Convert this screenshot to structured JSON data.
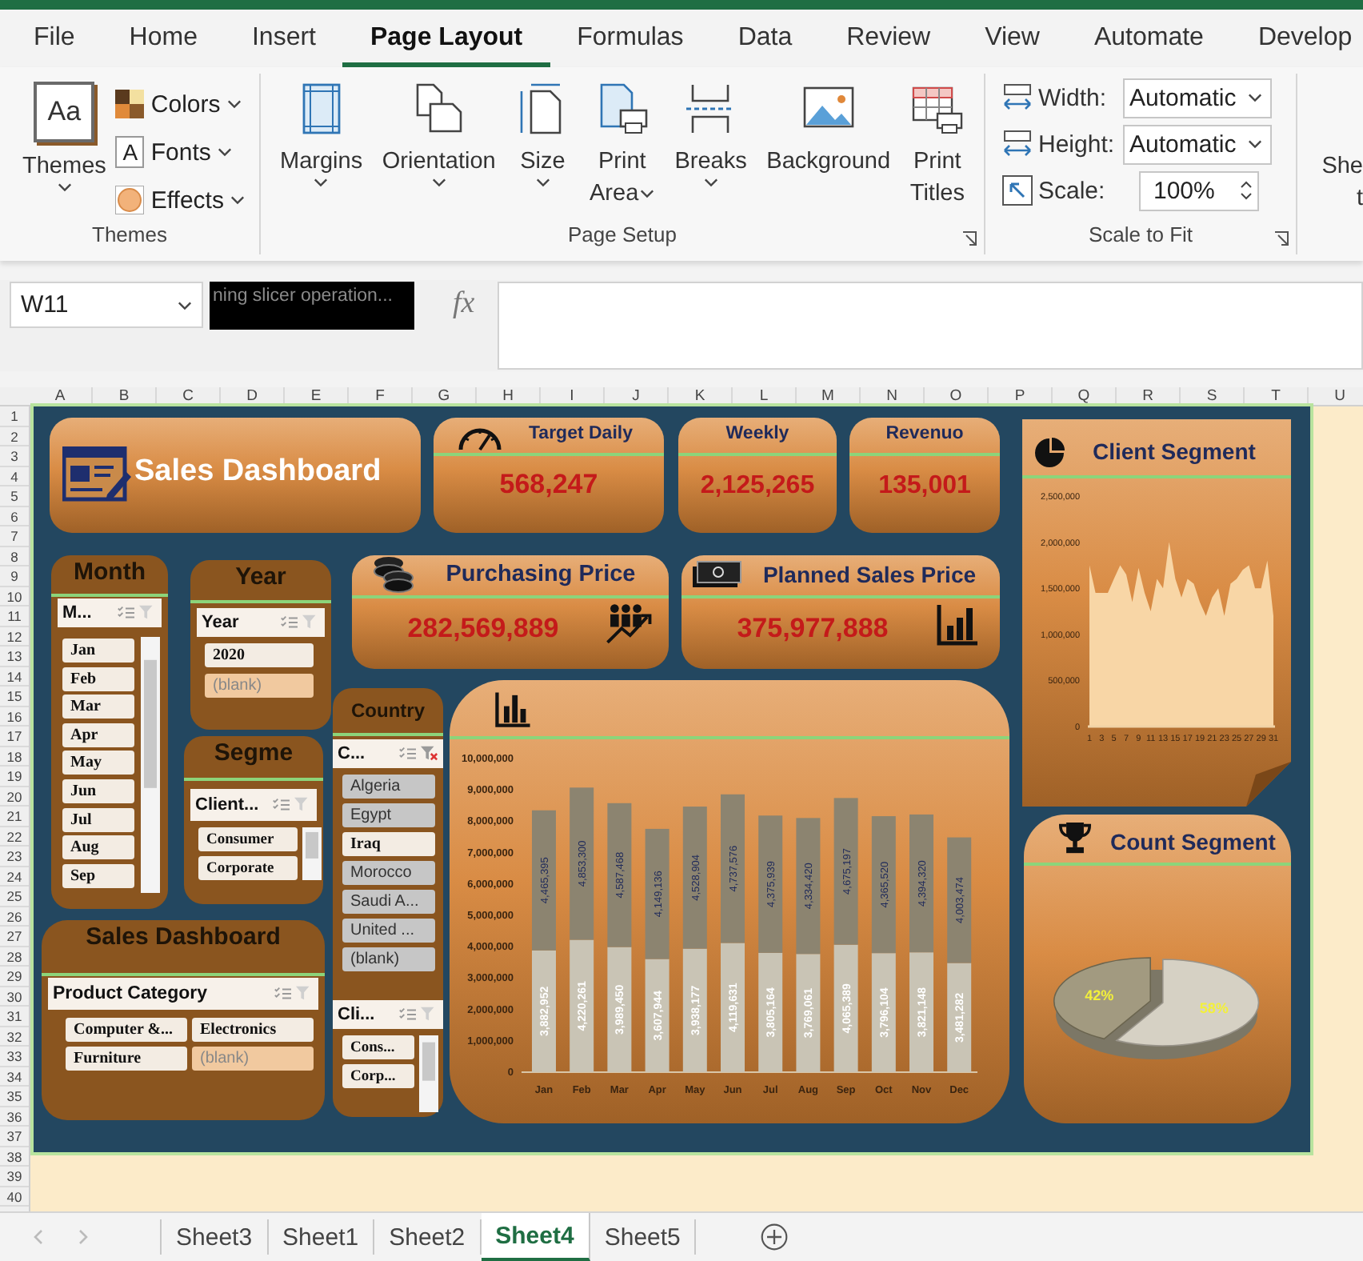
{
  "ribbon_tabs": [
    {
      "label": "File",
      "selected": false
    },
    {
      "label": "Home",
      "selected": false
    },
    {
      "label": "Insert",
      "selected": false
    },
    {
      "label": "Page Layout",
      "selected": true
    },
    {
      "label": "Formulas",
      "selected": false
    },
    {
      "label": "Data",
      "selected": false
    },
    {
      "label": "Review",
      "selected": false
    },
    {
      "label": "View",
      "selected": false
    },
    {
      "label": "Automate",
      "selected": false
    },
    {
      "label": "Develop",
      "selected": false
    }
  ],
  "themes_group": {
    "label": "Themes",
    "themes_button": {
      "icon_text": "Aa",
      "label": "Themes"
    },
    "options": [
      {
        "label": "Colors",
        "kind": "colors"
      },
      {
        "label": "Fonts",
        "kind": "fonts",
        "icon_text": "A"
      },
      {
        "label": "Effects",
        "kind": "effects"
      }
    ]
  },
  "page_setup_group": {
    "label": "Page Setup",
    "buttons": [
      {
        "lines": [
          "Margins"
        ],
        "kind": "margins",
        "dropdown": true
      },
      {
        "lines": [
          "Orientation"
        ],
        "kind": "orientation",
        "dropdown": true
      },
      {
        "lines": [
          "Size"
        ],
        "kind": "size",
        "dropdown": true
      },
      {
        "lines": [
          "Print",
          "Area"
        ],
        "kind": "print_area",
        "dropdown": true
      },
      {
        "lines": [
          "Breaks"
        ],
        "kind": "breaks",
        "dropdown": true
      },
      {
        "lines": [
          "Background"
        ],
        "kind": "background",
        "dropdown": false
      },
      {
        "lines": [
          "Print",
          "Titles"
        ],
        "kind": "print_titles",
        "dropdown": false
      }
    ]
  },
  "scale_group": {
    "label": "Scale to Fit",
    "fields": [
      {
        "label": "Width:",
        "value": "Automatic",
        "kind": "select"
      },
      {
        "label": "Height:",
        "value": "Automatic",
        "kind": "select"
      },
      {
        "label": "Scale:",
        "value": "100%",
        "kind": "spinner"
      }
    ]
  },
  "cut_group": {
    "lines": [
      "She",
      "t"
    ]
  },
  "formula_bar": {
    "name_box": "W11",
    "overlay_text": "ning slicer operation...",
    "fx": "fx"
  },
  "sheet": {
    "columns": [
      "A",
      "B",
      "C",
      "D",
      "E",
      "F",
      "G",
      "H",
      "I",
      "J",
      "K",
      "L",
      "M",
      "N",
      "O",
      "P",
      "Q",
      "R",
      "S",
      "T",
      "U"
    ],
    "rows": [
      "1",
      "2",
      "3",
      "4",
      "5",
      "6",
      "7",
      "8",
      "9",
      "10",
      "11",
      "12",
      "13",
      "14",
      "15",
      "16",
      "17",
      "18",
      "19",
      "20",
      "21",
      "22",
      "23",
      "24",
      "25",
      "26",
      "27",
      "28",
      "29",
      "30",
      "31",
      "32",
      "33",
      "34",
      "35",
      "36",
      "37",
      "38",
      "39",
      "40"
    ]
  },
  "dashboard": {
    "title_card": {
      "title": "Sales Dashboard"
    },
    "kpis": [
      {
        "title": "Target Daily",
        "value": "568,247"
      },
      {
        "title": "Weekly",
        "value": "2,125,265"
      },
      {
        "title": "Revenuo",
        "value": "135,001"
      }
    ],
    "purchasing_price": {
      "title": "Purchasing Price",
      "value": "282,569,889"
    },
    "planned_sales_price": {
      "title": "Planned Sales Price",
      "value": "375,977,888"
    },
    "month_slicer": {
      "title": "Month",
      "header": "M...",
      "filter_active": false,
      "items": [
        {
          "label": "Jan",
          "selected": true
        },
        {
          "label": "Feb",
          "selected": true
        },
        {
          "label": "Mar",
          "selected": true
        },
        {
          "label": "Apr",
          "selected": true
        },
        {
          "label": "May",
          "selected": true
        },
        {
          "label": "Jun",
          "selected": true
        },
        {
          "label": "Jul",
          "selected": true
        },
        {
          "label": "Aug",
          "selected": true
        },
        {
          "label": "Sep",
          "selected": true
        }
      ]
    },
    "year_slicer": {
      "title": "Year",
      "header": "Year",
      "filter_active": false,
      "items": [
        {
          "label": "2020",
          "selected": true
        },
        {
          "label": "(blank)",
          "selected": false
        }
      ]
    },
    "segment_slicer": {
      "title": "Segme",
      "header": "Client...",
      "filter_active": false,
      "items": [
        {
          "label": "Consumer",
          "selected": true
        },
        {
          "label": "Corporate",
          "selected": true
        }
      ]
    },
    "country_slicer": {
      "title": "Country",
      "header": "C...",
      "filter_active": true,
      "items": [
        {
          "label": "Algeria",
          "selected": false
        },
        {
          "label": "Egypt",
          "selected": false
        },
        {
          "label": "Iraq",
          "selected": true
        },
        {
          "label": "Morocco",
          "selected": false
        },
        {
          "label": "Saudi A...",
          "selected": false
        },
        {
          "label": "United ...",
          "selected": false
        },
        {
          "label": "(blank)",
          "selected": false
        }
      ]
    },
    "client_slicer": {
      "header": "Cli...",
      "filter_active": false,
      "items": [
        {
          "label": "Cons...",
          "selected": true
        },
        {
          "label": "Corp...",
          "selected": true
        }
      ]
    },
    "category_slicer": {
      "title": "Sales Dashboard",
      "header": "Product Category",
      "filter_active": false,
      "items": [
        {
          "label": "Computer &...",
          "selected": true
        },
        {
          "label": "Electronics",
          "selected": true
        },
        {
          "label": "Furniture",
          "selected": true
        },
        {
          "label": "(blank)",
          "selected": false
        }
      ]
    },
    "sales_chart": {
      "chart_data": {
        "type": "bar",
        "stacked": true,
        "orientation": "vertical",
        "categories": [
          "Jan",
          "Feb",
          "Mar",
          "Apr",
          "May",
          "Jun",
          "Jul",
          "Aug",
          "Sep",
          "Oct",
          "Nov",
          "Dec"
        ],
        "ylim": [
          0,
          10000000
        ],
        "yticks": [
          0,
          {
            "value": 1000000,
            "label": "1,000,000"
          },
          {
            "value": 2000000,
            "label": "2,000,000"
          },
          {
            "value": 3000000,
            "label": "3,000,000"
          },
          {
            "value": 4000000,
            "label": "4,000,000"
          },
          {
            "value": 5000000,
            "label": "5,000,000"
          },
          {
            "value": 6000000,
            "label": "6,000,000"
          },
          {
            "value": 7000000,
            "label": "7,000,000"
          },
          {
            "value": 8000000,
            "label": "8,000,000"
          },
          {
            "value": 9000000,
            "label": "9,000,000"
          },
          {
            "value": 10000000,
            "label": "10,000,000"
          }
        ],
        "series": [
          {
            "color": "#c9c4b5",
            "values": [
              3882952,
              4220261,
              3989450,
              3607944,
              3938177,
              4119631,
              3805164,
              3769061,
              4065389,
              3796104,
              3821148,
              3481282
            ],
            "value_labels": [
              "3,882,952",
              "4,220,261",
              "3,989,450",
              "3,607,944",
              "3,938,177",
              "4,119,631",
              "3,805,164",
              "3,769,061",
              "4,065,389",
              "3,796,104",
              "3,821,148",
              "3,481,282"
            ]
          },
          {
            "color": "#8c8470",
            "values": [
              4465395,
              4853300,
              4587468,
              4149136,
              4528904,
              4737576,
              4375939,
              4334420,
              4675197,
              4365520,
              4394320,
              4003474
            ],
            "value_labels": [
              "4,465,395",
              "4,853,300",
              "4,587,468",
              "4,149,136",
              "4,528,904",
              "4,737,576",
              "4,375,939",
              "4,334,420",
              "4,675,197",
              "4,365,520",
              "4,394,320",
              "4,003,474"
            ]
          }
        ]
      }
    },
    "client_segment": {
      "title": "Client Segment",
      "chart_data": {
        "type": "area",
        "x": [
          1,
          2,
          3,
          4,
          5,
          6,
          7,
          8,
          9,
          10,
          11,
          12,
          13,
          14,
          15,
          16,
          17,
          18,
          19,
          20,
          21,
          22,
          23,
          24,
          25,
          26,
          27,
          28,
          29,
          30,
          31
        ],
        "xlim": [
          1,
          31
        ],
        "xticks": [
          1,
          3,
          5,
          7,
          9,
          11,
          13,
          15,
          17,
          19,
          21,
          23,
          25,
          27,
          29,
          31
        ],
        "ylim": [
          0,
          2500000
        ],
        "yticks": [
          0,
          {
            "value": 500000,
            "label": "500,000"
          },
          {
            "value": 1000000,
            "label": "1,000,000"
          },
          {
            "value": 1500000,
            "label": "1,500,000"
          },
          {
            "value": 2000000,
            "label": "2,000,000"
          },
          {
            "value": 2500000,
            "label": "2,500,000"
          }
        ],
        "series": [
          {
            "color": "#f8d6a6",
            "values": [
              1750000,
              1450000,
              1450000,
              1450000,
              1600000,
              1750000,
              1650000,
              1350000,
              1720000,
              1450000,
              1250000,
              1600000,
              1500000,
              2000000,
              1600000,
              1400000,
              1600000,
              1550000,
              1350000,
              1200000,
              1400000,
              1500000,
              1200000,
              1550000,
              1600000,
              1700000,
              1750000,
              1500000,
              1500000,
              1800000,
              1200000
            ]
          }
        ]
      }
    },
    "count_segment": {
      "title": "Count Segment",
      "chart_data": {
        "type": "pie",
        "value_labels": [
          "42%",
          "58%"
        ],
        "series": [
          {
            "values": [
              42,
              58
            ]
          }
        ]
      }
    }
  },
  "sheet_tabs": [
    {
      "label": "Sheet3",
      "selected": false
    },
    {
      "label": "Sheet1",
      "selected": false
    },
    {
      "label": "Sheet2",
      "selected": false
    },
    {
      "label": "Sheet4",
      "selected": true
    },
    {
      "label": "Sheet5",
      "selected": false
    }
  ]
}
